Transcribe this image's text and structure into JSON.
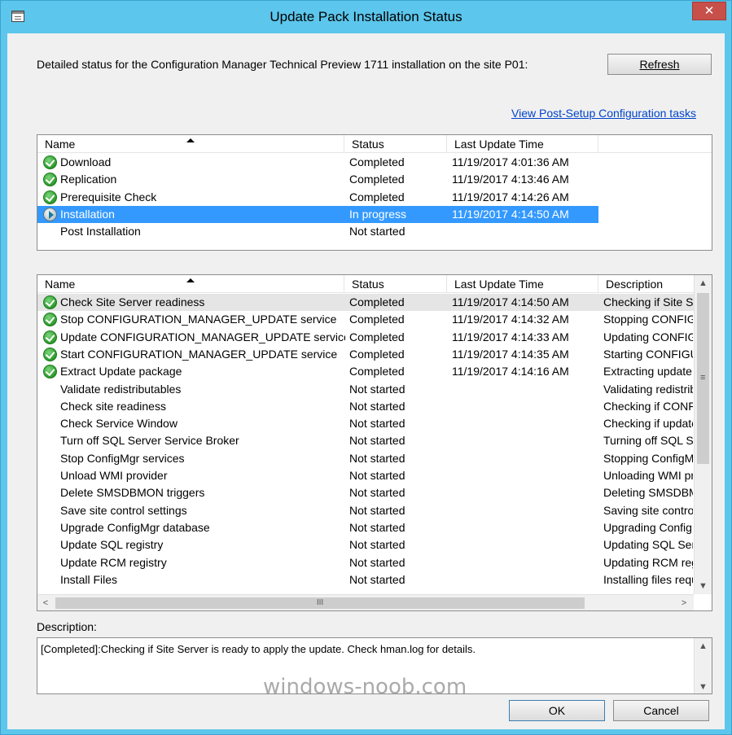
{
  "window": {
    "title": "Update Pack Installation Status",
    "close_glyph": "✕"
  },
  "status_label": "Detailed status for the Configuration Manager Technical Preview 1711 installation on the site P01:",
  "refresh_label": "Refresh",
  "post_setup_link": "View Post-Setup Configuration tasks",
  "top_list": {
    "columns": [
      "Name",
      "Status",
      "Last Update Time"
    ],
    "rows": [
      {
        "icon": "check",
        "name": "Download",
        "status": "Completed",
        "time": "11/19/2017 4:01:36 AM"
      },
      {
        "icon": "check",
        "name": "Replication",
        "status": "Completed",
        "time": "11/19/2017 4:13:46 AM"
      },
      {
        "icon": "check",
        "name": "Prerequisite Check",
        "status": "Completed",
        "time": "11/19/2017 4:14:26 AM"
      },
      {
        "icon": "play",
        "name": "Installation",
        "status": "In progress",
        "time": "11/19/2017 4:14:50 AM"
      },
      {
        "icon": "",
        "name": "Post Installation",
        "status": "Not started",
        "time": ""
      }
    ]
  },
  "bottom_list": {
    "columns": [
      "Name",
      "Status",
      "Last Update Time",
      "Description"
    ],
    "rows": [
      {
        "icon": "check",
        "name": "Check Site Server readiness",
        "status": "Completed",
        "time": "11/19/2017 4:14:50 AM",
        "desc": "Checking if Site Se"
      },
      {
        "icon": "check",
        "name": "Stop CONFIGURATION_MANAGER_UPDATE service",
        "status": "Completed",
        "time": "11/19/2017 4:14:32 AM",
        "desc": "Stopping CONFIGU"
      },
      {
        "icon": "check",
        "name": "Update CONFIGURATION_MANAGER_UPDATE service",
        "status": "Completed",
        "time": "11/19/2017 4:14:33 AM",
        "desc": "Updating CONFIG"
      },
      {
        "icon": "check",
        "name": "Start CONFIGURATION_MANAGER_UPDATE service",
        "status": "Completed",
        "time": "11/19/2017 4:14:35 AM",
        "desc": "Starting CONFIGU"
      },
      {
        "icon": "check",
        "name": "Extract Update package",
        "status": "Completed",
        "time": "11/19/2017 4:14:16 AM",
        "desc": "Extracting update p"
      },
      {
        "icon": "",
        "name": "Validate redistributables",
        "status": "Not started",
        "time": "",
        "desc": "Validating redistribu"
      },
      {
        "icon": "",
        "name": "Check site readiness",
        "status": "Not started",
        "time": "",
        "desc": "Checking if CONFI"
      },
      {
        "icon": "",
        "name": "Check Service Window",
        "status": "Not started",
        "time": "",
        "desc": "Checking if update"
      },
      {
        "icon": "",
        "name": "Turn off SQL Server Service Broker",
        "status": "Not started",
        "time": "",
        "desc": "Turning off SQL Se"
      },
      {
        "icon": "",
        "name": "Stop ConfigMgr services",
        "status": "Not started",
        "time": "",
        "desc": "Stopping ConfigMg"
      },
      {
        "icon": "",
        "name": "Unload WMI provider",
        "status": "Not started",
        "time": "",
        "desc": "Unloading WMI pro"
      },
      {
        "icon": "",
        "name": "Delete SMSDBMON triggers",
        "status": "Not started",
        "time": "",
        "desc": "Deleting SMSDBM"
      },
      {
        "icon": "",
        "name": "Save site control settings",
        "status": "Not started",
        "time": "",
        "desc": "Saving site control"
      },
      {
        "icon": "",
        "name": "Upgrade ConfigMgr database",
        "status": "Not started",
        "time": "",
        "desc": "Upgrading ConfigM"
      },
      {
        "icon": "",
        "name": "Update SQL registry",
        "status": "Not started",
        "time": "",
        "desc": "Updating SQL Serv"
      },
      {
        "icon": "",
        "name": "Update RCM registry",
        "status": "Not started",
        "time": "",
        "desc": "Updating RCM reg"
      },
      {
        "icon": "",
        "name": "Install Files",
        "status": "Not started",
        "time": "",
        "desc": "Installing files requi"
      }
    ]
  },
  "scroll_glyphs": {
    "up": "▲",
    "down": "▼",
    "left": "<",
    "right": ">",
    "grip_v": "≡",
    "grip_h": "III"
  },
  "description_label": "Description:",
  "description_text": "[Completed]:Checking if Site Server is ready to apply the update. Check hman.log for details.",
  "ok_label": "OK",
  "cancel_label": "Cancel",
  "watermark": "windows-noob.com"
}
